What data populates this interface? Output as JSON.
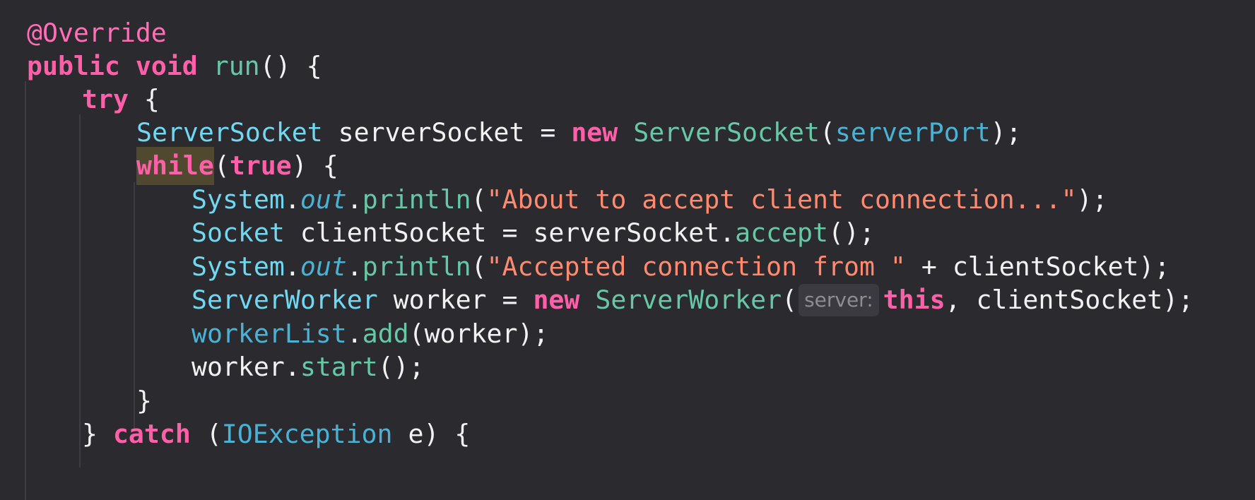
{
  "colors": {
    "background": "#2b2b2f",
    "keyword": "#ff5fa8",
    "annotation": "#ff6eb6",
    "method": "#67c8a6",
    "class": "#6fd8f2",
    "field": "#49b3d6",
    "string": "#ff8a70",
    "plain": "#f2f2f2",
    "hint_background": "#3a3a40",
    "hint_text": "#8c8c92",
    "match_highlight": "#50482f"
  },
  "editor": {
    "lines": [
      {
        "tokens": [
          {
            "t": "@Override",
            "k": "annotation"
          }
        ]
      },
      {
        "tokens": [
          {
            "t": "public",
            "k": "keyword"
          },
          {
            "t": " ",
            "k": "plain"
          },
          {
            "t": "void",
            "k": "keyword"
          },
          {
            "t": " ",
            "k": "plain"
          },
          {
            "t": "run",
            "k": "method"
          },
          {
            "t": "() {",
            "k": "punct"
          }
        ]
      },
      {
        "tokens": [
          {
            "t": "try",
            "k": "keyword"
          },
          {
            "t": " {",
            "k": "punct"
          }
        ]
      },
      {
        "tokens": [
          {
            "t": "ServerSocket",
            "k": "class"
          },
          {
            "t": " serverSocket = ",
            "k": "plain"
          },
          {
            "t": "new",
            "k": "keyword"
          },
          {
            "t": " ",
            "k": "plain"
          },
          {
            "t": "ServerSocket",
            "k": "class-new"
          },
          {
            "t": "(",
            "k": "punct"
          },
          {
            "t": "serverPort",
            "k": "field"
          },
          {
            "t": ");",
            "k": "punct"
          }
        ]
      },
      {
        "tokens": [
          {
            "t": "while",
            "k": "highlight"
          },
          {
            "t": "(",
            "k": "punct"
          },
          {
            "t": "true",
            "k": "keyword"
          },
          {
            "t": ") {",
            "k": "punct"
          }
        ]
      },
      {
        "tokens": [
          {
            "t": "System",
            "k": "class"
          },
          {
            "t": ".",
            "k": "punct"
          },
          {
            "t": "out",
            "k": "static"
          },
          {
            "t": ".",
            "k": "punct"
          },
          {
            "t": "println",
            "k": "method"
          },
          {
            "t": "(",
            "k": "punct"
          },
          {
            "t": "\"About to accept client connection...\"",
            "k": "string"
          },
          {
            "t": ");",
            "k": "punct"
          }
        ]
      },
      {
        "tokens": [
          {
            "t": "Socket",
            "k": "class"
          },
          {
            "t": " clientSocket = serverSocket.",
            "k": "plain"
          },
          {
            "t": "accept",
            "k": "method"
          },
          {
            "t": "();",
            "k": "punct"
          }
        ]
      },
      {
        "tokens": [
          {
            "t": "System",
            "k": "class"
          },
          {
            "t": ".",
            "k": "punct"
          },
          {
            "t": "out",
            "k": "static"
          },
          {
            "t": ".",
            "k": "punct"
          },
          {
            "t": "println",
            "k": "method"
          },
          {
            "t": "(",
            "k": "punct"
          },
          {
            "t": "\"Accepted connection from \"",
            "k": "string"
          },
          {
            "t": " + clientSocket);",
            "k": "plain"
          }
        ]
      },
      {
        "tokens": [
          {
            "t": "ServerWorker",
            "k": "class"
          },
          {
            "t": " worker = ",
            "k": "plain"
          },
          {
            "t": "new",
            "k": "keyword"
          },
          {
            "t": " ",
            "k": "plain"
          },
          {
            "t": "ServerWorker",
            "k": "class-new"
          },
          {
            "t": "(",
            "k": "punct"
          },
          {
            "t": "server:",
            "k": "hint"
          },
          {
            "t": "this",
            "k": "keyword"
          },
          {
            "t": ", clientSocket);",
            "k": "plain"
          }
        ]
      },
      {
        "tokens": [
          {
            "t": "workerList",
            "k": "field"
          },
          {
            "t": ".",
            "k": "punct"
          },
          {
            "t": "add",
            "k": "method"
          },
          {
            "t": "(worker);",
            "k": "plain"
          }
        ]
      },
      {
        "tokens": [
          {
            "t": "worker.",
            "k": "plain"
          },
          {
            "t": "start",
            "k": "method"
          },
          {
            "t": "();",
            "k": "punct"
          }
        ]
      },
      {
        "tokens": [
          {
            "t": "}",
            "k": "punct"
          }
        ]
      },
      {
        "tokens": [
          {
            "t": "} ",
            "k": "punct"
          },
          {
            "t": "catch",
            "k": "keyword"
          },
          {
            "t": " (",
            "k": "punct"
          },
          {
            "t": "IOException",
            "k": "field"
          },
          {
            "t": " e) {",
            "k": "plain"
          }
        ]
      }
    ]
  }
}
